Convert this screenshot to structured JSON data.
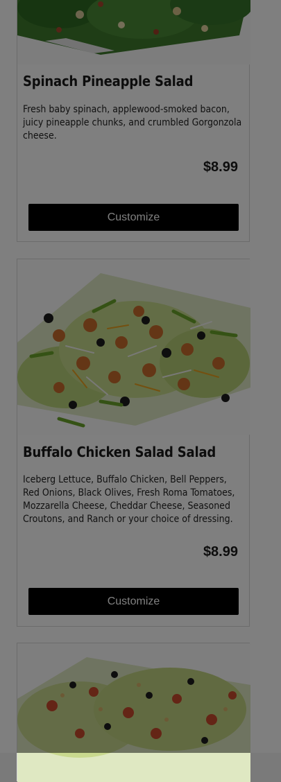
{
  "menu": {
    "items": [
      {
        "name": "Spinach Pineapple Salad",
        "description": "Fresh baby spinach, applewood-smoked bacon, juicy pineapple chunks, and crumbled Gorgonzola cheese.",
        "price": "$8.99",
        "button_label": "Customize"
      },
      {
        "name": "Buffalo Chicken Salad Salad",
        "description": "Iceberg Lettuce, Buffalo Chicken, Bell Peppers, Red Onions, Black Olives, Fresh Roma Tomatoes, Mozzarella Cheese, Cheddar Cheese, Seasoned Croutons, and Ranch or your choice of dressing.",
        "price": "$8.99",
        "button_label": "Customize"
      }
    ]
  },
  "colors": {
    "button_bg": "#000000",
    "overlay": "rgba(0,0,0,0.5)",
    "lettuce": "#7fb33a",
    "tomato": "#c8412a",
    "olive": "#1c1c1c"
  },
  "icons": [
    "salad-photo"
  ]
}
